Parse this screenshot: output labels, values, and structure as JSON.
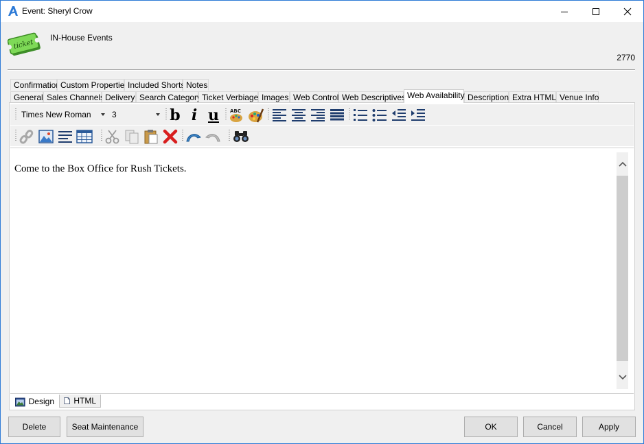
{
  "window": {
    "title": "Event: Sheryl Crow",
    "colors": {
      "accent": "#2b79d6",
      "panel": "#f0f0f0",
      "button": "#e1e1e1",
      "ticket_green": "#7ed957"
    }
  },
  "header": {
    "icon_label": "ticket",
    "org_name": "IN-House Events",
    "event_id": "2770"
  },
  "tabs_row1": [
    {
      "label": "Confirmation"
    },
    {
      "label": "Custom Properties"
    },
    {
      "label": "Included Shorts"
    },
    {
      "label": "Notes"
    }
  ],
  "tabs_row2": [
    {
      "label": "General"
    },
    {
      "label": "Sales Channels"
    },
    {
      "label": "Delivery"
    },
    {
      "label": "Search Category"
    },
    {
      "label": "Ticket Verbiage"
    },
    {
      "label": "Images"
    },
    {
      "label": "Web Control"
    },
    {
      "label": "Web Descriptives"
    },
    {
      "label": "Web Availability",
      "active": true
    },
    {
      "label": "Description"
    },
    {
      "label": "Extra HTML"
    },
    {
      "label": "Venue Info"
    }
  ],
  "editor_toolbar": {
    "font_family": "Times New Roman",
    "font_size": "3",
    "bold_label": "b",
    "italic_label": "i",
    "underline_label": "u",
    "spell_label": "ABC"
  },
  "editor": {
    "content": "Come to the Box Office for Rush Tickets."
  },
  "editor_tabs": [
    {
      "label": "Design",
      "icon": "design-icon"
    },
    {
      "label": "HTML",
      "icon": "html-page-icon"
    }
  ],
  "buttons": {
    "delete": "Delete",
    "seat_maintenance": "Seat Maintenance",
    "ok": "OK",
    "cancel": "Cancel",
    "apply": "Apply"
  }
}
